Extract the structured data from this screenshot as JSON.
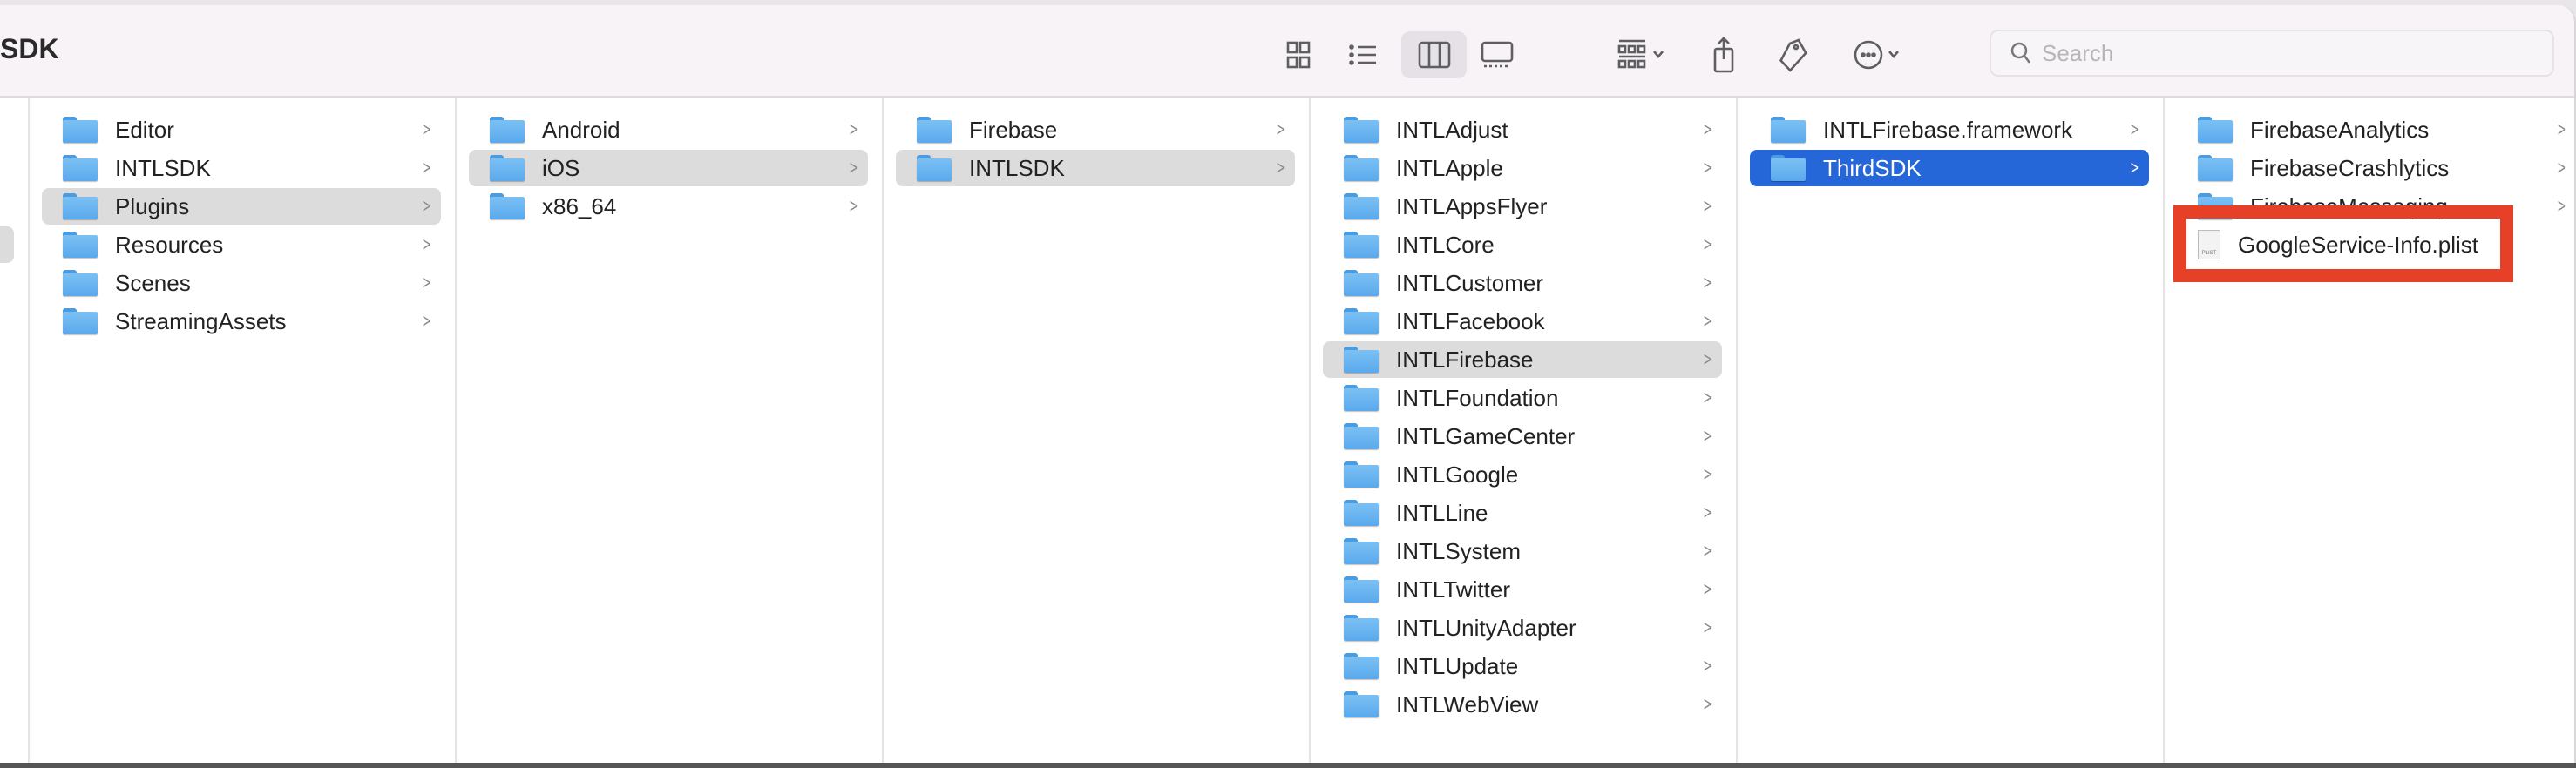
{
  "window": {
    "title": "SDK"
  },
  "toolbar": {
    "icons": [
      "icon-view-icon",
      "list-view-icon",
      "column-view-icon",
      "gallery-view-icon",
      "group-icon",
      "share-icon",
      "tag-icon",
      "more-actions-icon"
    ],
    "active_view": "column",
    "search_placeholder": "Search"
  },
  "colors": {
    "selection_active": "#2566d8",
    "selection_inactive": "#dcdcdc",
    "highlight_box": "#e64029"
  },
  "columns": [
    {
      "items": [
        {
          "name": "Editor"
        },
        {
          "name": "INTLSDK"
        },
        {
          "name": "Plugins",
          "state": "sel"
        },
        {
          "name": "Resources"
        },
        {
          "name": "Scenes"
        },
        {
          "name": "StreamingAssets"
        }
      ]
    },
    {
      "items": [
        {
          "name": "Android"
        },
        {
          "name": "iOS",
          "state": "sel"
        },
        {
          "name": "x86_64"
        }
      ]
    },
    {
      "items": [
        {
          "name": "Firebase"
        },
        {
          "name": "INTLSDK",
          "state": "sel"
        }
      ]
    },
    {
      "items": [
        {
          "name": "INTLAdjust"
        },
        {
          "name": "INTLApple"
        },
        {
          "name": "INTLAppsFlyer"
        },
        {
          "name": "INTLCore"
        },
        {
          "name": "INTLCustomer"
        },
        {
          "name": "INTLFacebook"
        },
        {
          "name": "INTLFirebase",
          "state": "sel"
        },
        {
          "name": "INTLFoundation"
        },
        {
          "name": "INTLGameCenter"
        },
        {
          "name": "INTLGoogle"
        },
        {
          "name": "INTLLine"
        },
        {
          "name": "INTLSystem"
        },
        {
          "name": "INTLTwitter"
        },
        {
          "name": "INTLUnityAdapter"
        },
        {
          "name": "INTLUpdate"
        },
        {
          "name": "INTLWebView"
        }
      ]
    },
    {
      "items": [
        {
          "name": "INTLFirebase.framework"
        },
        {
          "name": "ThirdSDK",
          "state": "act"
        }
      ]
    },
    {
      "items": [
        {
          "name": "FirebaseAnalytics"
        },
        {
          "name": "FirebaseCrashlytics"
        },
        {
          "name": "FirebaseMessaging"
        },
        {
          "name": "GoogleService-Info.plist",
          "type": "file",
          "file_badge": "PLIST",
          "highlighted": true
        }
      ]
    }
  ]
}
